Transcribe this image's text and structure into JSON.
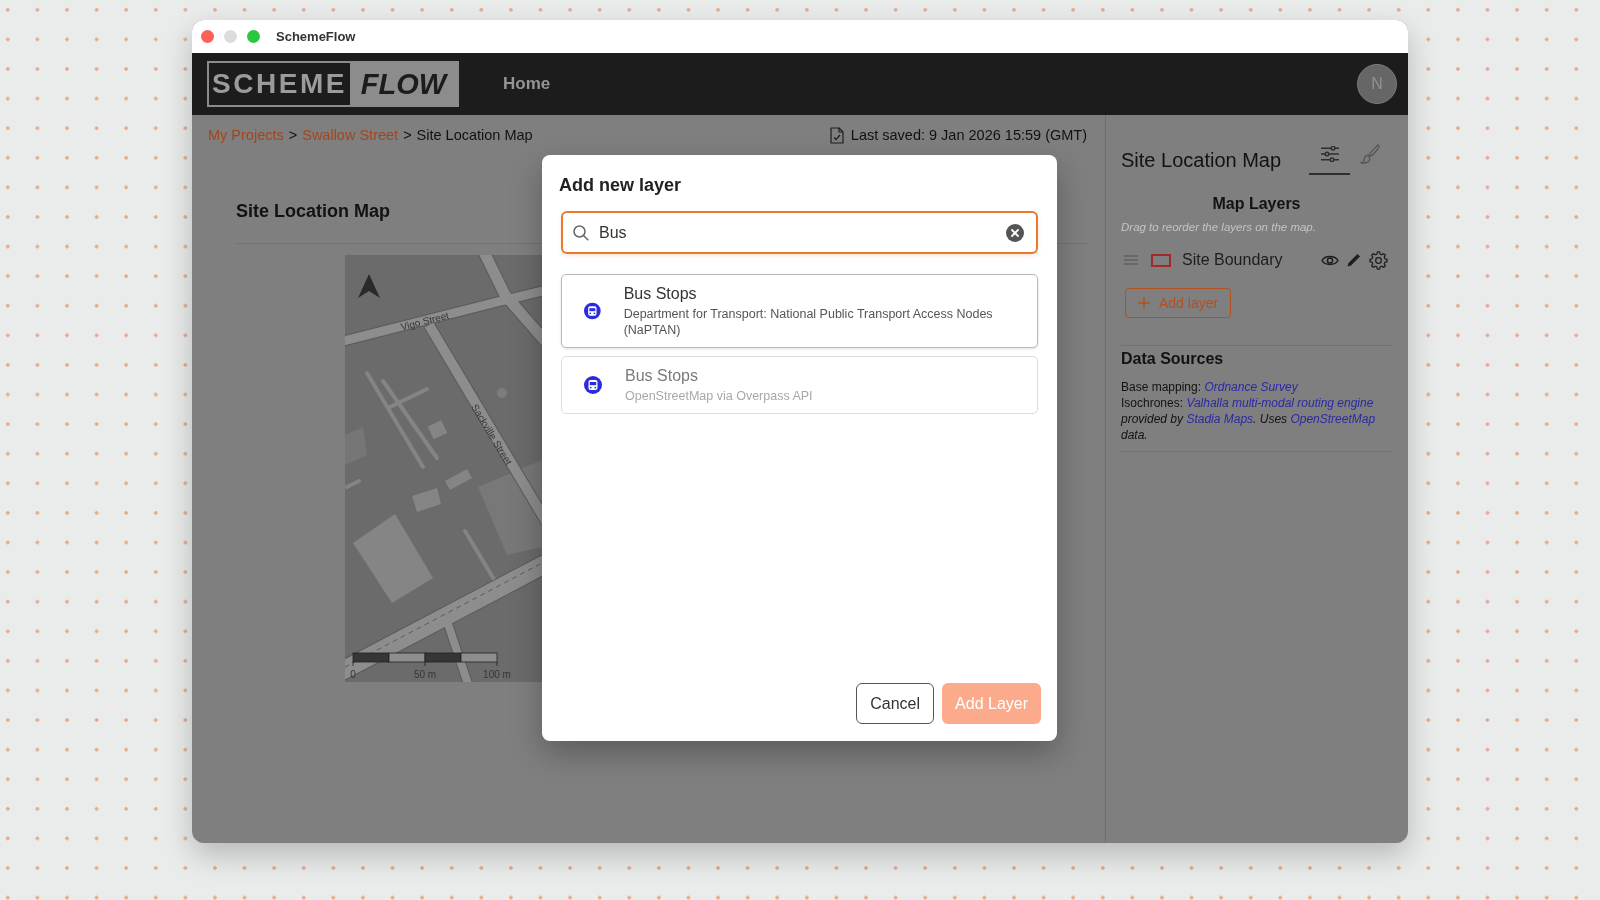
{
  "window": {
    "title": "SchemeFlow"
  },
  "header": {
    "logo": {
      "left": "SCHEME",
      "right": "FLOW"
    },
    "nav": [
      {
        "label": "Home"
      }
    ],
    "avatar": "N"
  },
  "breadcrumb": [
    {
      "kind": "link",
      "text": "My Projects"
    },
    {
      "kind": "separator",
      "text": ">"
    },
    {
      "kind": "link",
      "text": "Swallow Street"
    },
    {
      "kind": "separator",
      "text": ">"
    },
    {
      "kind": "current",
      "text": "Site Location Map"
    }
  ],
  "last_saved": "Last saved: 9 Jan 2026 15:59 (GMT)",
  "main": {
    "title": "Site Location Map",
    "map": {
      "street_labels": [
        "Vigo Street",
        "Sackville Street"
      ],
      "scale_labels": [
        "0",
        "50 m",
        "100 m"
      ]
    }
  },
  "panel": {
    "title": "Site Location Map",
    "tabs": [
      {
        "kind": "layers",
        "selected": true
      },
      {
        "kind": "style",
        "selected": false
      }
    ],
    "layers_heading": "Map Layers",
    "layers_hint": "Drag to reorder the layers on the map.",
    "layers": [
      {
        "name": "Site Boundary",
        "color": "#a32a2a",
        "visible": true
      }
    ],
    "add_button": "Add layer",
    "sources_heading": "Data Sources",
    "sources": [
      [
        {
          "kind": "plain",
          "text": "Base mapping: "
        },
        {
          "kind": "link",
          "text": "Ordnance Survey"
        }
      ],
      [
        {
          "kind": "plain",
          "text": "Isochrones: "
        },
        {
          "kind": "link",
          "text": "Valhalla multi-modal routing engine"
        },
        {
          "kind": "note",
          "text": " provided by "
        },
        {
          "kind": "link",
          "text": "Stadia Maps"
        },
        {
          "kind": "note",
          "text": ". Uses "
        },
        {
          "kind": "link",
          "text": "OpenStreetMap"
        },
        {
          "kind": "note",
          "text": " data."
        }
      ]
    ]
  },
  "dialog": {
    "title": "Add new layer",
    "search": {
      "value": "Bus"
    },
    "results": [
      {
        "title": "Bus Stops",
        "description": "Department for Transport: National Public Transport Access Nodes (NaPTAN)",
        "disabled": false
      },
      {
        "title": "Bus Stops",
        "description": "OpenStreetMap via Overpass API",
        "disabled": true
      }
    ],
    "buttons": [
      {
        "label": "Cancel",
        "kind": "secondary",
        "disabled": false
      },
      {
        "label": "Add Layer",
        "kind": "primary",
        "disabled": true
      }
    ]
  }
}
